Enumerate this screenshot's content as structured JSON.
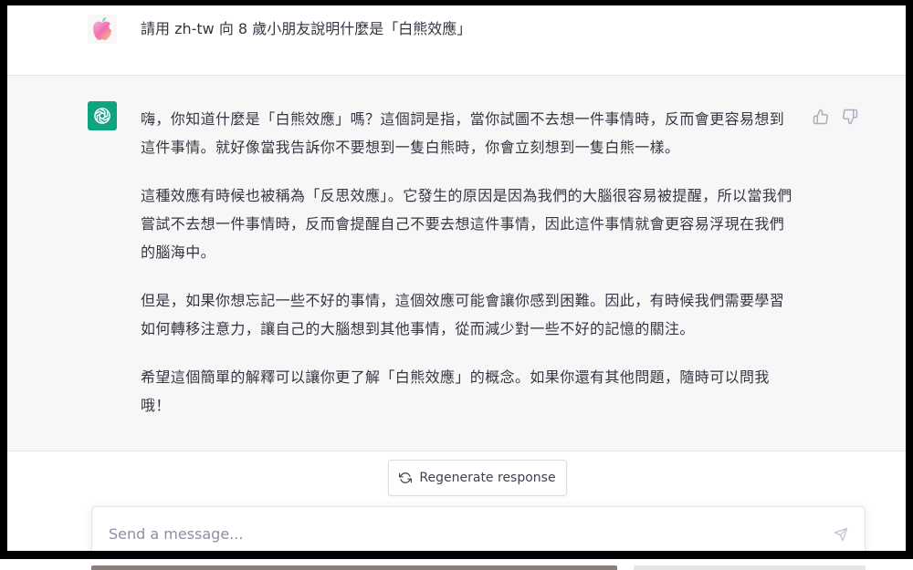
{
  "colors": {
    "assistant_bg": "#f7f7f8",
    "gpt_green": "#10a37f",
    "text": "#343541",
    "placeholder": "#8e8ea0"
  },
  "user": {
    "avatar_icon": "apple-logo-icon",
    "message": "請用 zh-tw 向 8 歲小朋友說明什麼是「白熊效應」"
  },
  "assistant": {
    "avatar_icon": "openai-logo-icon",
    "paragraphs": [
      "嗨，你知道什麼是「白熊效應」嗎？這個詞是指，當你試圖不去想一件事情時，反而會更容易想到這件事情。就好像當我告訴你不要想到一隻白熊時，你會立刻想到一隻白熊一樣。",
      "這種效應有時候也被稱為「反思效應」。它發生的原因是因為我們的大腦很容易被提醒，所以當我們嘗試不去想一件事情時，反而會提醒自己不要去想這件事情，因此這件事情就會更容易浮現在我們的腦海中。",
      "但是，如果你想忘記一些不好的事情，這個效應可能會讓你感到困難。因此，有時候我們需要學習如何轉移注意力，讓自己的大腦想到其他事情，從而減少對一些不好的記憶的關注。",
      "希望這個簡單的解釋可以讓你更了解「白熊效應」的概念。如果你還有其他問題，隨時可以問我哦！"
    ],
    "feedback_icons": [
      "thumbs-up-icon",
      "thumbs-down-icon"
    ]
  },
  "regenerate": {
    "icon": "refresh-icon",
    "label": "Regenerate response"
  },
  "composer": {
    "placeholder": "Send a message...",
    "value": "",
    "send_icon": "send-icon"
  }
}
